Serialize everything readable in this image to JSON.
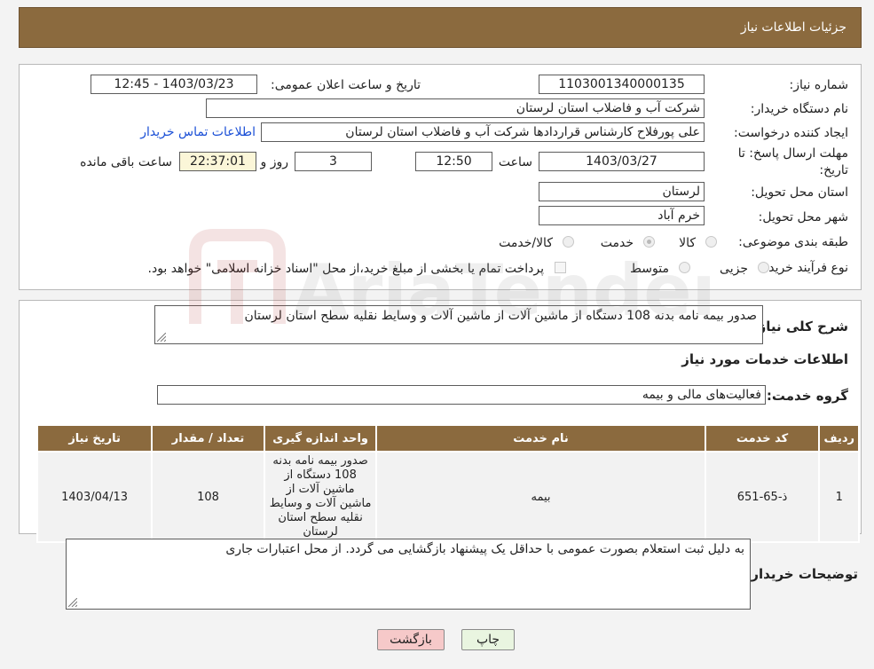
{
  "header": {
    "title": "جزئیات اطلاعات نیاز"
  },
  "form": {
    "need_number_label": "شماره نیاز:",
    "need_number": "1103001340000135",
    "announce_label": "تاریخ و ساعت اعلان عمومی:",
    "announce_value": "1403/03/23 - 12:45",
    "buyer_org_label": "نام دستگاه خریدار:",
    "buyer_org": "شرکت آب و فاضلاب استان لرستان",
    "creator_label": "ایجاد کننده درخواست:",
    "creator": "علی پورفلاح کارشناس قراردادها شرکت آب و فاضلاب استان لرستان",
    "contact_link": "اطلاعات تماس خریدار",
    "deadline_label_1": "مهلت ارسال پاسخ: تا",
    "deadline_label_2": "تاریخ:",
    "deadline_date": "1403/03/27",
    "time_label": "ساعت",
    "deadline_time": "12:50",
    "days_value": "3",
    "days_label": "روز و",
    "remaining_time": "22:37:01",
    "remaining_label": "ساعت باقی مانده",
    "province_label": "استان محل تحویل:",
    "province": "لرستان",
    "city_label": "شهر محل تحویل:",
    "city": "خرم آباد",
    "category_label": "طبقه بندی موضوعی:",
    "category_options": [
      "کالا",
      "خدمت",
      "کالا/خدمت"
    ],
    "category_selected": "خدمت",
    "process_label": "نوع فرآیند خرید :",
    "process_options": [
      "جزیی",
      "متوسط"
    ],
    "payment_note": "پرداخت تمام یا بخشی از مبلغ خرید،از محل \"اسناد خزانه اسلامی\" خواهد بود."
  },
  "summary": {
    "label": "شرح کلی نیاز:",
    "text": "صدور بیمه نامه بدنه 108 دستگاه از ماشین آلات از ماشین آلات و وسایط نقلیه سطح استان لرستان"
  },
  "services": {
    "section_title": "اطلاعات خدمات مورد نیاز",
    "group_label": "گروه خدمت:",
    "group_value": "فعالیت‌های مالی و بیمه",
    "columns": [
      "ردیف",
      "کد خدمت",
      "نام خدمت",
      "واحد اندازه گیری",
      "تعداد / مقدار",
      "تاریخ نیاز"
    ],
    "rows": [
      {
        "row": "1",
        "code": "ذ-65-651",
        "name": "بیمه",
        "unit": "صدور بیمه نامه بدنه 108 دستگاه از ماشین آلات از ماشین آلات و وسایط نقلیه سطح استان لرستان",
        "qty": "108",
        "date": "1403/04/13"
      }
    ]
  },
  "buyer_notes": {
    "label": "توضیحات خریدار:",
    "text": "به دلیل ثبت استعلام بصورت عمومی با حداقل یک پیشنهاد بازگشایی می گردد. از محل اعتبارات جاری"
  },
  "buttons": {
    "print": "چاپ",
    "back": "بازگشت"
  },
  "watermark": {
    "text": "AriaTender.neT"
  },
  "colors": {
    "header_bg": "#8b6a3e",
    "link": "#1a4fd6",
    "back_button_bg": "#f6c9c9",
    "print_button_bg": "#e9f5e0"
  }
}
